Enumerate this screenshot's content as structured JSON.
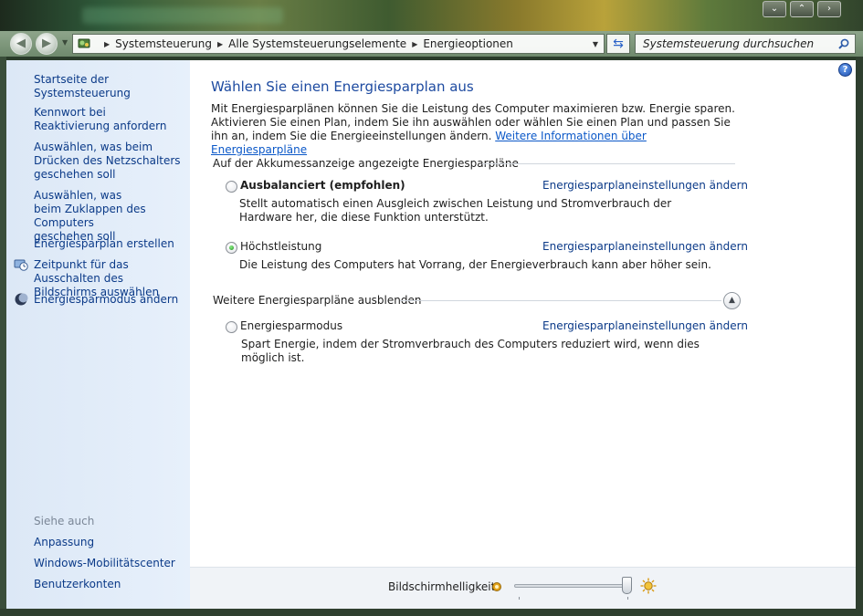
{
  "window": {
    "controls": {
      "minimize": "⌄",
      "maximize": "⌃",
      "close": "›"
    }
  },
  "address": {
    "crumbs": [
      "Systemsteuerung",
      "Alle Systemsteuerungselemente",
      "Energieoptionen"
    ],
    "search_placeholder": "Systemsteuerung durchsuchen"
  },
  "sidebar": {
    "home": "Startseite der Systemsteuerung",
    "items": [
      {
        "label": "Kennwort bei Reaktivierung anfordern",
        "icon": ""
      },
      {
        "label": "Auswählen, was beim Drücken des Netzschalters geschehen soll",
        "icon": ""
      },
      {
        "label": "Auswählen, was beim Zuklappen des Computers geschehen soll",
        "icon": ""
      },
      {
        "label": "Energiesparplan erstellen",
        "icon": ""
      },
      {
        "label": "Zeitpunkt für das Ausschalten des Bildschirms auswählen",
        "icon": "monitor-clock-icon"
      },
      {
        "label": "Energiesparmodus ändern",
        "icon": "moon-icon"
      }
    ],
    "see_also_title": "Siehe auch",
    "see_also": [
      "Anpassung",
      "Windows-Mobilitätscenter",
      "Benutzerkonten"
    ]
  },
  "main": {
    "title": "Wählen Sie einen Energiesparplan aus",
    "intro": "Mit Energiesparplänen können Sie die Leistung des Computer maximieren bzw. Energie sparen. Aktivieren Sie einen Plan, indem Sie ihn auswählen oder wählen Sie einen Plan und passen Sie ihn an, indem Sie die Energieeinstellungen ändern.",
    "intro_link": "Weitere Informationen über Energiesparpläne",
    "group1_title": "Auf der Akkumessanzeige angezeigte Energiesparpläne",
    "group2_title": "Weitere Energiesparpläne ausblenden",
    "plans": [
      {
        "name": "Ausbalanciert (empfohlen)",
        "selected": false,
        "link": "Energiesparplaneinstellungen ändern",
        "description": "Stellt automatisch einen Ausgleich zwischen Leistung und Stromverbrauch der Hardware her, die diese Funktion unterstützt."
      },
      {
        "name": "Höchstleistung",
        "selected": true,
        "link": "Energiesparplaneinstellungen ändern",
        "description": "Die Leistung des Computers hat Vorrang, der Energieverbrauch kann aber höher sein."
      },
      {
        "name": "Energiesparmodus",
        "selected": false,
        "link": "Energiesparplaneinstellungen ändern",
        "description": "Spart Energie, indem der Stromverbrauch des Computers reduziert wird, wenn dies möglich ist."
      }
    ]
  },
  "footer": {
    "brightness_label": "Bildschirmhelligkeit:",
    "brightness_level": 1.0
  },
  "colors": {
    "link": "#0b3a88",
    "title": "#1d4aa0",
    "sidebar_bg": "#dce8f6",
    "selected_radio": "#1e8a1e"
  }
}
